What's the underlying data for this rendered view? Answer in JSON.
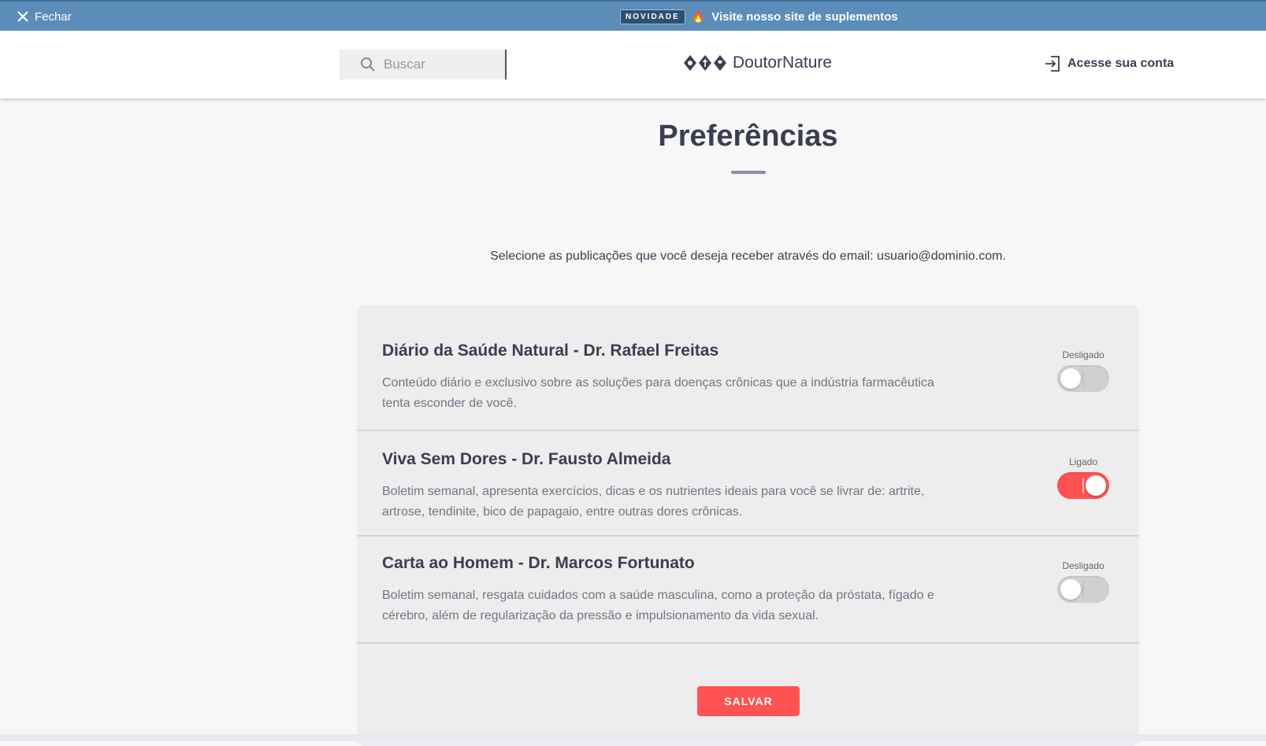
{
  "banner": {
    "close_label": "Fechar",
    "badge": "NOVIDADE",
    "promo_text": "Visite nosso site de suplementos",
    "close_icon": "close-icon",
    "flame_icon": "flame-icon"
  },
  "header": {
    "search_placeholder": "Buscar",
    "search_icon": "search-icon",
    "brand": "DoutorNature",
    "account_label": "Acesse sua conta",
    "account_icon": "login-icon"
  },
  "main": {
    "title": "Preferências",
    "intro": "Selecione as publicações que você deseja receber através do email: usuario@dominio.com.",
    "items": [
      {
        "title": "Diário da Saúde Natural - Dr. Rafael Freitas",
        "description": "Conteúdo diário e exclusivo sobre as soluções para doenças crônicas que a indústria farmacêutica tenta esconder de você.",
        "state_label": "Desligado",
        "enabled": false
      },
      {
        "title": "Viva Sem Dores - Dr. Fausto Almeida",
        "description": "Boletim semanal, apresenta exercícios, dicas e os nutrientes ideais para você se livrar de: artrite, artrose, tendinite, bico de papagaio, entre outras dores crônicas.",
        "state_label": "Ligado",
        "enabled": true
      },
      {
        "title": "Carta ao Homem - Dr. Marcos Fortunato",
        "description": "Boletim semanal, resgata cuidados com a saúde masculina, como a proteção da próstata, fígado e cérebro, além de regularização da pressão e impulsionamento da vida sexual.",
        "state_label": "Desligado",
        "enabled": false
      }
    ],
    "save_label": "SALVAR"
  },
  "colors": {
    "banner": "#5b8db8",
    "accent": "#ff5252",
    "text": "#3b3d52",
    "card": "#eeecec"
  }
}
